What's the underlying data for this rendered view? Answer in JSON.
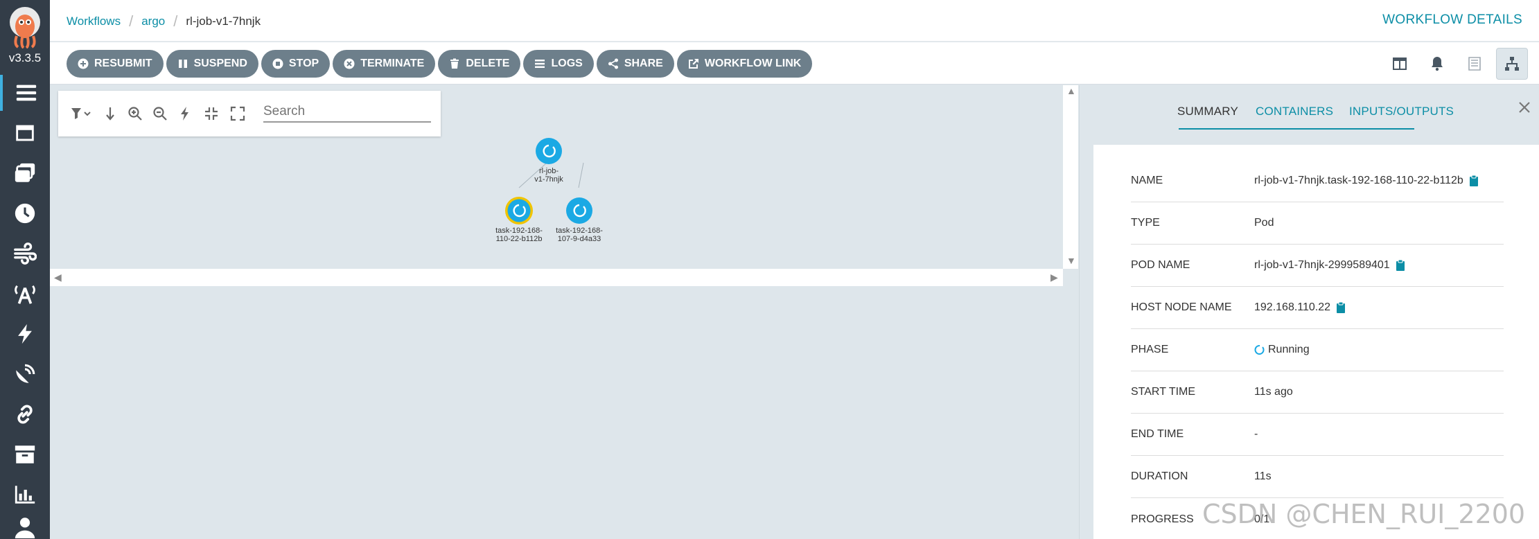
{
  "app": {
    "version": "v3.3.5",
    "page_title": "WORKFLOW DETAILS"
  },
  "breadcrumb": [
    "Workflows",
    "argo",
    "rl-job-v1-7hnjk"
  ],
  "sidebar": {
    "items": [
      {
        "icon": "workflows-icon",
        "active": true
      },
      {
        "icon": "workflow-templates-icon"
      },
      {
        "icon": "cluster-workflow-templates-icon"
      },
      {
        "icon": "cron-workflows-icon"
      },
      {
        "icon": "event-flow-icon"
      },
      {
        "icon": "event-sources-icon"
      },
      {
        "icon": "sensors-icon"
      },
      {
        "icon": "event-bus-icon"
      },
      {
        "icon": "api-docs-icon"
      },
      {
        "icon": "archived-workflows-icon"
      },
      {
        "icon": "reports-icon"
      },
      {
        "icon": "user-icon"
      }
    ]
  },
  "toolbar": {
    "buttons": [
      {
        "label": "RESUBMIT",
        "icon": "plus-circle-icon"
      },
      {
        "label": "SUSPEND",
        "icon": "pause-icon"
      },
      {
        "label": "STOP",
        "icon": "stop-circle-icon"
      },
      {
        "label": "TERMINATE",
        "icon": "times-circle-icon"
      },
      {
        "label": "DELETE",
        "icon": "trash-icon"
      },
      {
        "label": "LOGS",
        "icon": "bars-icon"
      },
      {
        "label": "SHARE",
        "icon": "share-icon"
      },
      {
        "label": "WORKFLOW LINK",
        "icon": "external-link-icon"
      }
    ]
  },
  "graph": {
    "search_placeholder": "Search",
    "nodes": [
      {
        "label_line1": "rl-job-",
        "label_line2": "v1-7hnjk"
      },
      {
        "label_line1": "task-192-168-",
        "label_line2": "110-22-b112b"
      },
      {
        "label_line1": "task-192-168-",
        "label_line2": "107-9-d4a33"
      }
    ]
  },
  "details": {
    "tabs": [
      "SUMMARY",
      "CONTAINERS",
      "INPUTS/OUTPUTS"
    ],
    "rows": [
      {
        "key": "NAME",
        "value": "rl-job-v1-7hnjk.task-192-168-110-22-b112b",
        "copy": true
      },
      {
        "key": "TYPE",
        "value": "Pod"
      },
      {
        "key": "POD NAME",
        "value": "rl-job-v1-7hnjk-2999589401",
        "copy": true
      },
      {
        "key": "HOST NODE NAME",
        "value": "192.168.110.22",
        "copy": true
      },
      {
        "key": "PHASE",
        "value": "Running"
      },
      {
        "key": "START TIME",
        "value": "11s ago"
      },
      {
        "key": "END TIME",
        "value": "-"
      },
      {
        "key": "DURATION",
        "value": "11s"
      },
      {
        "key": "PROGRESS",
        "value": "0/1"
      }
    ]
  },
  "watermark": "CSDN @CHEN_RUI_2200",
  "colors": {
    "accent": "#0c8ea6",
    "node": "#1ba9e4",
    "selected": "#f0c400",
    "sidebar": "#333d48",
    "button": "#6d7f8b"
  }
}
